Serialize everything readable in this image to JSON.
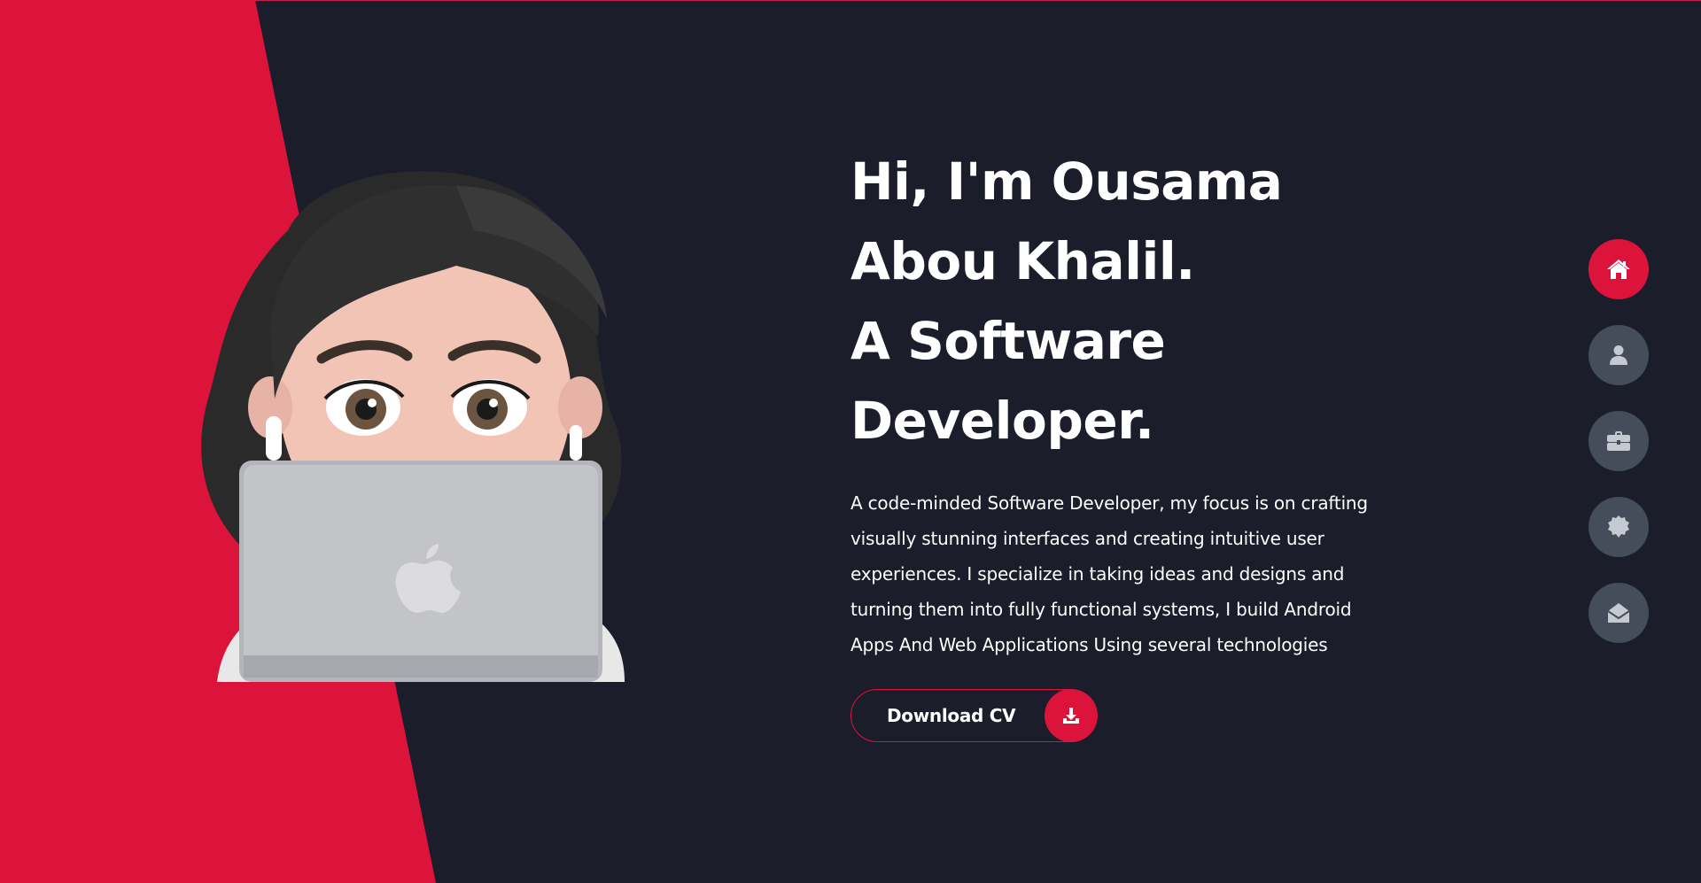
{
  "colors": {
    "accent": "#dc143c",
    "background": "#1b1d2b",
    "nav_inactive": "#454d5b",
    "text": "#ffffff"
  },
  "hero": {
    "title_lines": [
      "Hi, I'm Ousama",
      "Abou Khalil.",
      "A Software",
      "Developer."
    ],
    "description": "A code-minded Software Developer, my focus is on crafting visually stunning interfaces and creating intuitive user experiences. I specialize in taking ideas and designs and turning them into fully functional systems, I build Android Apps And Web Applications Using several technologies",
    "cv_button_label": "Download CV",
    "cv_button_icon": "download-icon"
  },
  "side_nav": {
    "items": [
      {
        "icon": "home-icon",
        "active": true
      },
      {
        "icon": "user-icon",
        "active": false
      },
      {
        "icon": "briefcase-icon",
        "active": false
      },
      {
        "icon": "badge-icon",
        "active": false
      },
      {
        "icon": "envelope-open-icon",
        "active": false
      }
    ]
  }
}
